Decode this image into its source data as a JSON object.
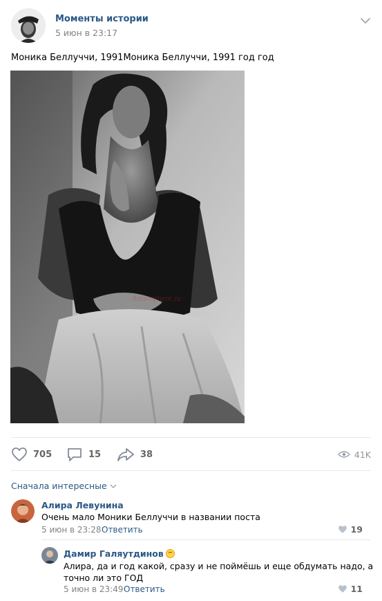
{
  "post": {
    "author": "Моменты истории",
    "date": "5 июн в 23:17",
    "text": "Моника Беллуччи, 1991Моника Беллуччи, 1991 год год",
    "photo_watermark": "Atmosphere.ru"
  },
  "actions": {
    "likes": "705",
    "comments": "15",
    "shares": "38",
    "views": "41K"
  },
  "comments_section": {
    "sort_label": "Сначала интересные"
  },
  "comments": [
    {
      "author": "Алира Левунина",
      "text": "Очень мало Моники Беллуччи в названии поста",
      "date": "5 июн в 23:28",
      "reply_label": "Ответить",
      "likes": "19"
    },
    {
      "author": "Дамир Галяутдинов",
      "text_line1": "Алира, да и год какой, сразу и не поймёшь и еще обдумать надо, а",
      "text_line2": "точно ли это ГОД",
      "date": "5 июн в 23:49",
      "reply_label": "Ответить",
      "likes": "11"
    }
  ],
  "colors": {
    "link_blue": "#2a5885",
    "icon_gray": "#828a99",
    "divider": "#e7e8ec"
  },
  "icons": [
    "chevron-down-icon",
    "heart-icon",
    "comment-icon",
    "share-icon",
    "eye-icon"
  ]
}
